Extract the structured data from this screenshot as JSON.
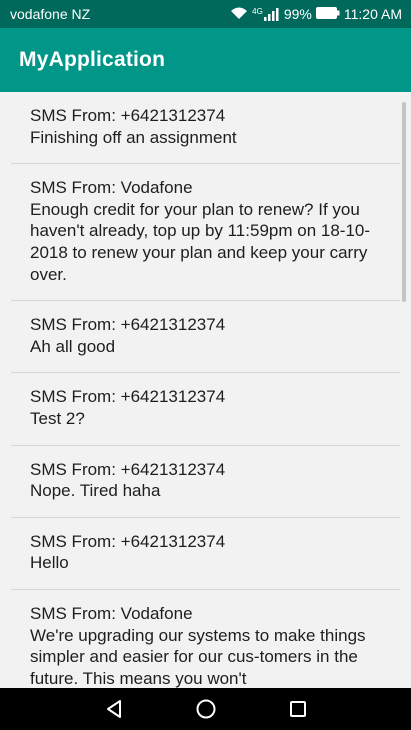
{
  "status_bar": {
    "carrier": "vodafone NZ",
    "network_type": "4G",
    "battery": "99%",
    "time": "11:20 AM",
    "icons": [
      "wifi-icon",
      "signal-icon",
      "battery-icon"
    ]
  },
  "app_bar": {
    "title": "MyApplication"
  },
  "messages": [
    {
      "from": "SMS From: +6421312374",
      "body": "Finishing off an assignment"
    },
    {
      "from": "SMS From: Vodafone",
      "body": "Enough credit for your plan to renew? If you haven't already, top up by 11:59pm on 18-10-2018 to renew your plan and keep your carry over."
    },
    {
      "from": "SMS From: +6421312374",
      "body": "Ah all good"
    },
    {
      "from": "SMS From: +6421312374",
      "body": "Test 2?"
    },
    {
      "from": "SMS From: +6421312374",
      "body": "Nope. Tired haha"
    },
    {
      "from": "SMS From: +6421312374",
      "body": "Hello"
    },
    {
      "from": "SMS From: Vodafone",
      "body": "We're upgrading our systems to make things simpler and easier for our cus-tomers in the future. This means you won't"
    }
  ],
  "nav_bar": {
    "buttons": [
      "back-icon",
      "home-icon",
      "recents-icon"
    ]
  },
  "colors": {
    "status_bar": "#00695c",
    "app_bar": "#009688",
    "list_background": "#f2f2f2",
    "divider": "#d6d6d6",
    "nav_bar": "#000000"
  }
}
